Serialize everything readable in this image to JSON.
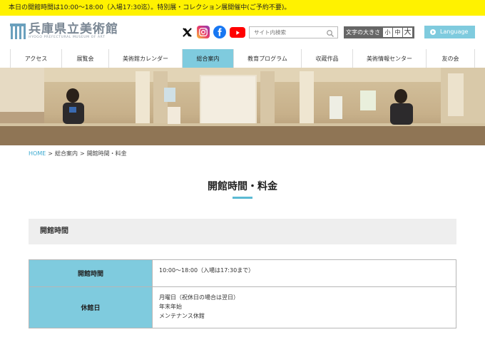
{
  "notice": "本日の開館時間は10:00〜18:00（入場17:30迄）。特別展・コレクション展開催中(ご予約不要)。",
  "logo": {
    "name_jp": "兵庫県立美術館",
    "name_en": "HYOGO PREFECTURAL MUSEUM OF ART"
  },
  "social": [
    "x-icon",
    "instagram-icon",
    "facebook-icon",
    "youtube-icon"
  ],
  "search": {
    "placeholder": "サイト内検索"
  },
  "font_size": {
    "label": "文字の大きさ",
    "small": "小",
    "medium": "中",
    "large": "大"
  },
  "language": {
    "label": "Language"
  },
  "nav": [
    {
      "label": "アクセス"
    },
    {
      "label": "展覧会"
    },
    {
      "label": "美術館カレンダー"
    },
    {
      "label": "総合案内",
      "active": true
    },
    {
      "label": "教育プログラム"
    },
    {
      "label": "収蔵作品"
    },
    {
      "label": "美術情報センター"
    },
    {
      "label": "友の会"
    }
  ],
  "breadcrumb": {
    "home": "HOME",
    "separator": ">",
    "level1": "総合案内",
    "current": "開館時間・料金"
  },
  "page_title": "開館時間・料金",
  "section": {
    "heading": "開館時間",
    "rows": [
      {
        "header": "開館時間",
        "lines": [
          "10:00〜18:00（入場は17:30まで）"
        ]
      },
      {
        "header": "休館日",
        "lines": [
          "月曜日（祝休日の場合は翌日）",
          "年末年始",
          "メンテナンス休館"
        ]
      }
    ]
  },
  "colors": {
    "notice_bg": "#fff200",
    "accent": "#7fcbde",
    "link": "#3aa9d0"
  }
}
